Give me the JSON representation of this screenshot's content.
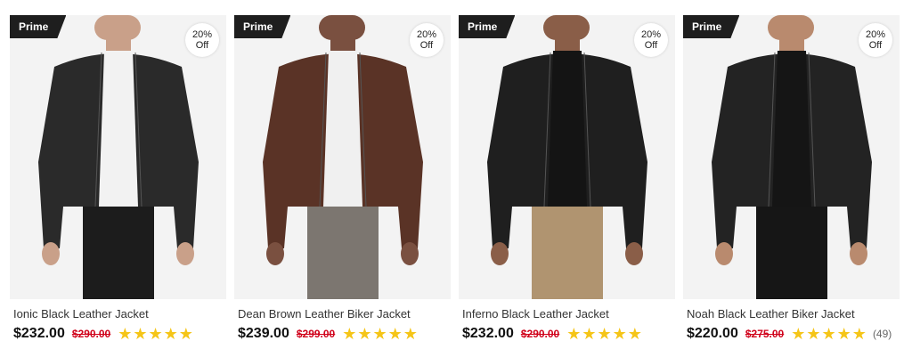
{
  "products": [
    {
      "badge": "Prime",
      "discount_value": "20%",
      "discount_label": "Off",
      "name": "Ionic Black Leather Jacket",
      "price": "$232.00",
      "old_price": "$290.00",
      "rating": 5,
      "reviews": "",
      "jacket_color": "#2a2a2a",
      "shirt_color": "#f2f2f2",
      "pants_color": "#1c1c1c"
    },
    {
      "badge": "Prime",
      "discount_value": "20%",
      "discount_label": "Off",
      "name": "Dean Brown Leather Biker Jacket",
      "price": "$239.00",
      "old_price": "$299.00",
      "rating": 5,
      "reviews": "",
      "jacket_color": "#5a3326",
      "shirt_color": "#f0f0f0",
      "pants_color": "#7c7670"
    },
    {
      "badge": "Prime",
      "discount_value": "20%",
      "discount_label": "Off",
      "name": "Inferno Black Leather Jacket",
      "price": "$232.00",
      "old_price": "$290.00",
      "rating": 5,
      "reviews": "",
      "jacket_color": "#1f1f1f",
      "shirt_color": "#141414",
      "pants_color": "#b09470"
    },
    {
      "badge": "Prime",
      "discount_value": "20%",
      "discount_label": "Off",
      "name": "Noah Black Leather Biker Jacket",
      "price": "$220.00",
      "old_price": "$275.00",
      "rating": 5,
      "reviews": "(49)",
      "jacket_color": "#232323",
      "shirt_color": "#151515",
      "pants_color": "#161616"
    }
  ],
  "colors": {
    "badge_bg": "#1e1e1e",
    "old_price": "#d0021b",
    "star": "#f5c518",
    "image_bg": "#f3f3f3"
  }
}
